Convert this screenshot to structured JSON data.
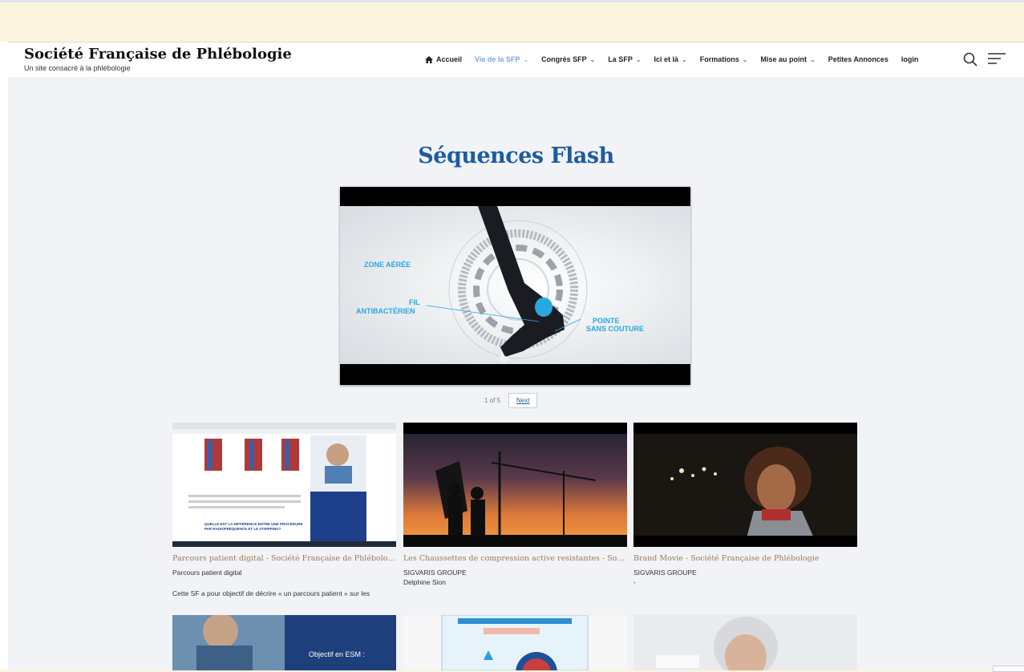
{
  "site": {
    "title": "Société Française de Phlébologie",
    "subtitle": "Un site consacré à la phlébologie"
  },
  "nav": {
    "items": [
      {
        "label": "Accueil",
        "icon": "home-icon",
        "dropdown": false,
        "active": false
      },
      {
        "label": "Vie de la SFP",
        "dropdown": true,
        "active": true
      },
      {
        "label": "Congrès SFP",
        "dropdown": true,
        "active": false
      },
      {
        "label": "La SFP",
        "dropdown": true,
        "active": false
      },
      {
        "label": "Ici et là",
        "dropdown": true,
        "active": false
      },
      {
        "label": "Formations",
        "dropdown": true,
        "active": false
      },
      {
        "label": "Mise au point",
        "dropdown": true,
        "active": false
      },
      {
        "label": "Petites Annonces",
        "dropdown": false,
        "active": false
      },
      {
        "label": "login",
        "dropdown": false,
        "active": false
      }
    ],
    "search_icon": "search-icon",
    "menu_icon": "hamburger-menu-icon",
    "active_color": "#7fa6d6"
  },
  "page": {
    "heading": "Séquences Flash",
    "heading_color": "#1f5b9e"
  },
  "video": {
    "labels": {
      "zone": "ZONE AÉRÉE",
      "fil_1": "FIL",
      "fil_2": "ANTIBACTÉRIEN",
      "pointe_1": "POINTE",
      "pointe_2": "SANS COUTURE"
    }
  },
  "pager": {
    "status": "1 of 5",
    "next_label": "Next"
  },
  "cards": [
    {
      "title": "Parcours patient digital - Société Française de Phlébologie",
      "line1": "Parcours patient digital",
      "line2": "",
      "description": "Cette SF a pour objectif de décrire « un parcours patient » sur les",
      "thumb_text": {
        "banner_1": "QUELLE EST LA DIFFÉRENCE ENTRE UNE PROCÉDURE",
        "banner_2": "PAR RADIOFRÉQUENCE ET LE STRIPPING?"
      }
    },
    {
      "title": "Les Chaussettes de compression active resistantes - Société Française de Phlébologie",
      "line1": "SIGVARIS GROUPE",
      "line2": "Delphine Sion",
      "description": ""
    },
    {
      "title": "Brand Movie - Société Française de Phlébologie",
      "line1": "SIGVARIS GROUPE",
      "line2": "-",
      "description": ""
    }
  ],
  "row2": [
    {
      "text": "Objectif en ESM :"
    },
    {
      "text": ""
    },
    {
      "text": ""
    }
  ]
}
